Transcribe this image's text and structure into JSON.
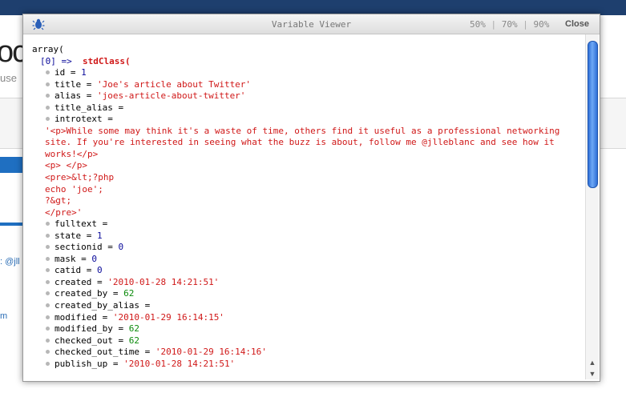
{
  "background": {
    "logo_text": "oc",
    "subtitle_fragment": "use",
    "link1": ": @jll",
    "link2": "m"
  },
  "modal": {
    "title": "Variable Viewer",
    "zoom_options": [
      "50%",
      "70%",
      "90%"
    ],
    "zoom_separator": "|",
    "close_label": "Close"
  },
  "dump": {
    "root": "array(",
    "index_key": "[0] =>",
    "index_class": "stdClass(",
    "fields": [
      {
        "key": "id",
        "value": "1",
        "type": "num"
      },
      {
        "key": "title",
        "value": "'Joe's article about Twitter'",
        "type": "str"
      },
      {
        "key": "alias",
        "value": "'joes-article-about-twitter'",
        "type": "str"
      },
      {
        "key": "title_alias",
        "value": "",
        "type": "none"
      },
      {
        "key": "introtext",
        "value": "",
        "type": "none"
      }
    ],
    "introtext_lines": [
      "'<p>While some may think it's a waste of time, others find it useful as a professional networking",
      "site. If you're interested in seeing what the buzz is about, follow me @jlleblanc and see how it",
      "works!</p>",
      "<p> </p>",
      "<pre>&lt;?php",
      "echo 'joe';",
      "?&gt;",
      "</pre>'"
    ],
    "fields2": [
      {
        "key": "fulltext",
        "value": "",
        "type": "none"
      },
      {
        "key": "state",
        "value": "1",
        "type": "num"
      },
      {
        "key": "sectionid",
        "value": "0",
        "type": "num"
      },
      {
        "key": "mask",
        "value": "0",
        "type": "num"
      },
      {
        "key": "catid",
        "value": "0",
        "type": "num"
      },
      {
        "key": "created",
        "value": "'2010-01-28 14:21:51'",
        "type": "str"
      },
      {
        "key": "created_by",
        "value": "62",
        "type": "numg"
      },
      {
        "key": "created_by_alias",
        "value": "",
        "type": "none"
      },
      {
        "key": "modified",
        "value": "'2010-01-29 16:14:15'",
        "type": "str"
      },
      {
        "key": "modified_by",
        "value": "62",
        "type": "numg"
      },
      {
        "key": "checked_out",
        "value": "62",
        "type": "numg"
      },
      {
        "key": "checked_out_time",
        "value": "'2010-01-29 16:14:16'",
        "type": "str"
      },
      {
        "key": "publish_up",
        "value": "'2010-01-28 14:21:51'",
        "type": "str"
      }
    ]
  },
  "colors": {
    "string": "#d01818",
    "number": "#0a0a9a",
    "number_green": "#0a8a0a",
    "header_bar": "#1e3f6e",
    "accent": "#1f6fc1"
  }
}
